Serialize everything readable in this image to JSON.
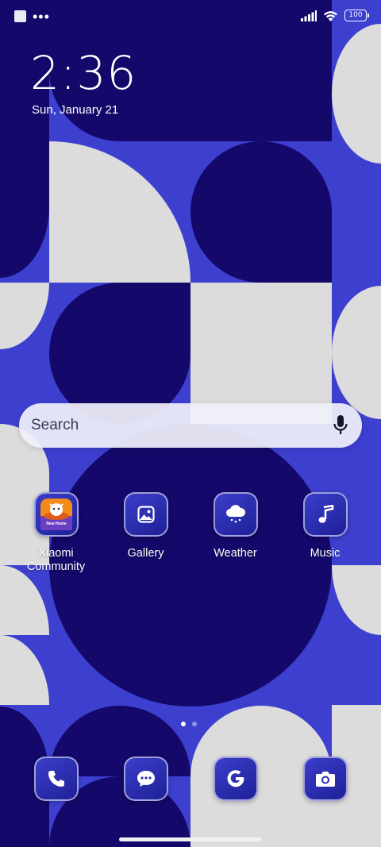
{
  "status_bar": {
    "battery": "100"
  },
  "clock": {
    "time": "2:36",
    "date": "Sun, January 21"
  },
  "search": {
    "placeholder": "Search"
  },
  "apps": [
    {
      "label": "Xiaomi\nCommunity",
      "icon": "xiaomi-community-icon"
    },
    {
      "label": "Gallery",
      "icon": "gallery-icon"
    },
    {
      "label": "Weather",
      "icon": "weather-icon"
    },
    {
      "label": "Music",
      "icon": "music-icon"
    }
  ],
  "dock": [
    {
      "icon": "phone-icon"
    },
    {
      "icon": "messages-icon"
    },
    {
      "icon": "google-icon"
    },
    {
      "icon": "camera-icon"
    }
  ],
  "pager": {
    "pages": 2,
    "active": 0
  },
  "colors": {
    "wallpaper_blue": "#3d3fcf",
    "wallpaper_navy": "#14086a",
    "wallpaper_gray": "#dcdcdc"
  },
  "xiaomi_icon_text": "New Home"
}
